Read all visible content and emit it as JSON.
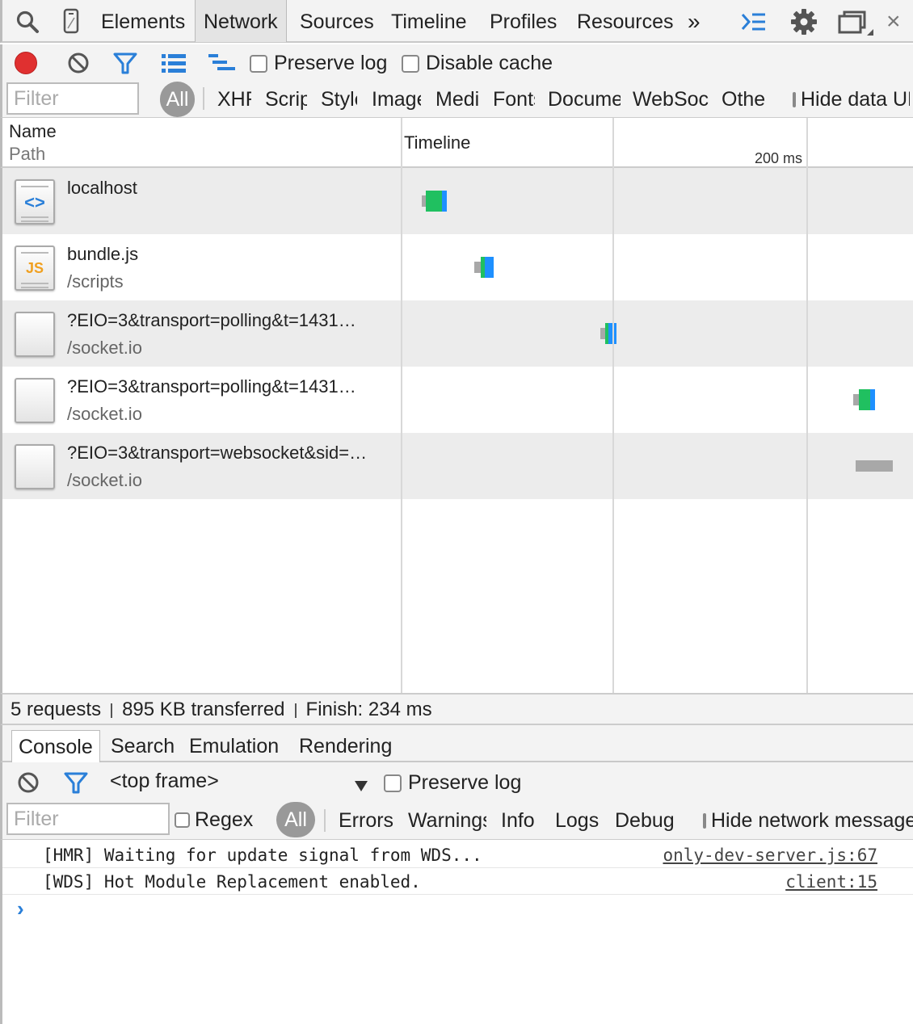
{
  "main_toolbar": {
    "tabs": [
      "Elements",
      "Network",
      "Sources",
      "Timeline",
      "Profiles",
      "Resources"
    ],
    "active_tab": "Network",
    "overflow": "»",
    "close": "×"
  },
  "network_toolbar": {
    "preserve_log": "Preserve log",
    "disable_cache": "Disable cache"
  },
  "network_filter": {
    "placeholder": "Filter",
    "all": "All",
    "types": [
      "XHR",
      "Scripts",
      "Styles",
      "Images",
      "Media",
      "Fonts",
      "Documents",
      "WebSockets",
      "Other"
    ],
    "hide_data": "Hide data URLs"
  },
  "table": {
    "name_header": "Name",
    "path_header": "Path",
    "timeline_header": "Timeline",
    "tick_label": "200 ms",
    "rows": [
      {
        "name": "localhost",
        "path": "",
        "icon": "html-document-icon",
        "glyph": "<>"
      },
      {
        "name": "bundle.js",
        "path": "/scripts",
        "icon": "javascript-file-icon",
        "glyph": "JS"
      },
      {
        "name": "?EIO=3&transport=polling&t=1431…",
        "path": "/socket.io",
        "icon": "blank-file-icon",
        "glyph": ""
      },
      {
        "name": "?EIO=3&transport=polling&t=1431…",
        "path": "/socket.io",
        "icon": "blank-file-icon",
        "glyph": ""
      },
      {
        "name": "?EIO=3&transport=websocket&sid=…",
        "path": "/socket.io",
        "icon": "blank-file-icon",
        "glyph": ""
      }
    ]
  },
  "summary": {
    "requests": "5 requests",
    "transferred": "895 KB transferred",
    "finish": "Finish: 234 ms"
  },
  "drawer": {
    "tabs": [
      "Console",
      "Search",
      "Emulation",
      "Rendering"
    ],
    "active_tab": "Console"
  },
  "console": {
    "context": "<top frame>",
    "preserve_log": "Preserve log",
    "filter_placeholder": "Filter",
    "regex": "Regex",
    "all": "All",
    "levels": [
      "Errors",
      "Warnings",
      "Info",
      "Logs",
      "Debug"
    ],
    "hide_network": "Hide network messages",
    "messages": [
      {
        "text": "[HMR] Waiting for update signal from WDS...",
        "source": "only-dev-server.js:67"
      },
      {
        "text": "[WDS] Hot Module Replacement enabled.",
        "source": "client:15"
      }
    ],
    "prompt": "›"
  },
  "colors": {
    "record": "#e03030",
    "accent_blue": "#2a7fd8",
    "bar_receive": "#20c060",
    "bar_download": "#1e90ff",
    "bar_wait": "#a8a8a8"
  }
}
